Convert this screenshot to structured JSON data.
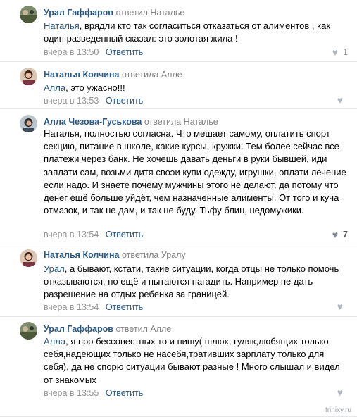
{
  "comments": [
    {
      "author": "Урал Гаффаров",
      "replied": "ответил Наталье",
      "mention": "Наталья",
      "text": ", врядли кто так согласиться отказаться от алиментов , как один разведенный сказал: это золотая жила !",
      "time": "вчера в 13:50",
      "reply_label": "Ответить",
      "likes": "1"
    },
    {
      "author": "Наталья Колчина",
      "replied": "ответила Алле",
      "mention": "Алла",
      "text": ", это ужасно!!!",
      "time": "вчера в 13:53",
      "reply_label": "Ответить",
      "likes": ""
    },
    {
      "author": "Алла Чезова-Гуськова",
      "replied": "ответила Наталье",
      "mention": "",
      "text": "Наталья, полностью согласна. Что мешает самому, оплатить спорт секцию, питание в школе, какие курсы, кружки. Тем более сейчас все платежи через банк. Не хочешь давать деньги в руки бывшей, иди заплати сам, возьми дитя своэи купи одежду, игрушки, оплати лечение если надо. И знаете почему мужчины этого не делают, да потому что денег ещё больше уйдёт, чем назначенные алименты. От того и куча отмазок, и так не дам, и так не буду. Тьфу блин, недомужики.",
      "time": "вчера в 13:54",
      "reply_label": "Ответить",
      "likes": "7"
    },
    {
      "author": "Наталья Колчина",
      "replied": "ответила Уралу",
      "mention": "Урал",
      "text": ", а бывают, кстати, такие ситуации, когда отцы не только помочь отказываются, но ещё и пытаются нагадить. Например не дать разрешение на отдых ребенка за границей.",
      "time": "вчера в 13:54",
      "reply_label": "Ответить",
      "likes": ""
    },
    {
      "author": "Урал Гаффаров",
      "replied": "ответил Алле",
      "mention": "Алла",
      "text": ", я про бессовестных то и пишу( шлюх, гуляк,любящих только себя,надеющих только не насебя,тративших зарплату только для себя), да не спорю ситуации бывают разные ! Много слышал и видел от знакомых",
      "time": "вчера в 13:55",
      "reply_label": "Ответить",
      "likes": ""
    }
  ],
  "watermark": "trinixy.ru",
  "colors": {
    "link": "#2a5885",
    "muted": "#939393",
    "divider": "#e7e8ec"
  },
  "icons": {
    "like": "heart-icon"
  }
}
